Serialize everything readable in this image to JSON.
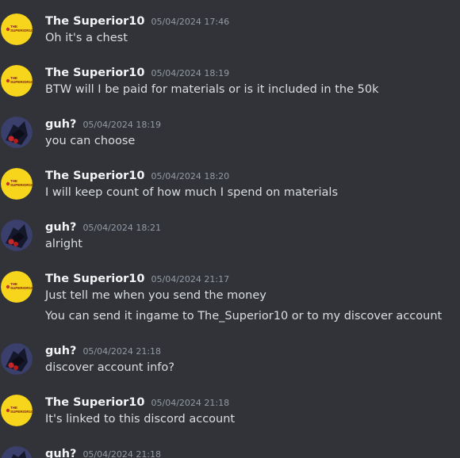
{
  "colors": {
    "background": "#313338",
    "username": "#f2f3f5",
    "timestamp": "#949ba4",
    "text": "#dbdee1",
    "superior_avatar_bg": "#f7d51d"
  },
  "users": {
    "superior": {
      "name": "The Superior10",
      "avatar_text": "THE SUPERIOR10"
    },
    "guh": {
      "name": "guh?"
    }
  },
  "messages": [
    {
      "author": "The Superior10",
      "timestamp": "05/04/2024 17:46",
      "lines": [
        "Oh it's a chest"
      ]
    },
    {
      "author": "The Superior10",
      "timestamp": "05/04/2024 18:19",
      "lines": [
        "BTW will I be paid for materials or is it included in the 50k"
      ]
    },
    {
      "author": "guh?",
      "timestamp": "05/04/2024 18:19",
      "lines": [
        "you can choose"
      ]
    },
    {
      "author": "The Superior10",
      "timestamp": "05/04/2024 18:20",
      "lines": [
        "I will keep count of how much I spend on materials"
      ]
    },
    {
      "author": "guh?",
      "timestamp": "05/04/2024 18:21",
      "lines": [
        "alright"
      ]
    },
    {
      "author": "The Superior10",
      "timestamp": "05/04/2024 21:17",
      "lines": [
        "Just tell me when you send the money",
        "You can send it ingame to The_Superior10 or to my discover account"
      ]
    },
    {
      "author": "guh?",
      "timestamp": "05/04/2024 21:18",
      "lines": [
        "discover account info?"
      ]
    },
    {
      "author": "The Superior10",
      "timestamp": "05/04/2024 21:18",
      "lines": [
        "It's linked to this discord account"
      ]
    },
    {
      "author": "guh?",
      "timestamp": "05/04/2024 21:18",
      "lines": []
    }
  ]
}
